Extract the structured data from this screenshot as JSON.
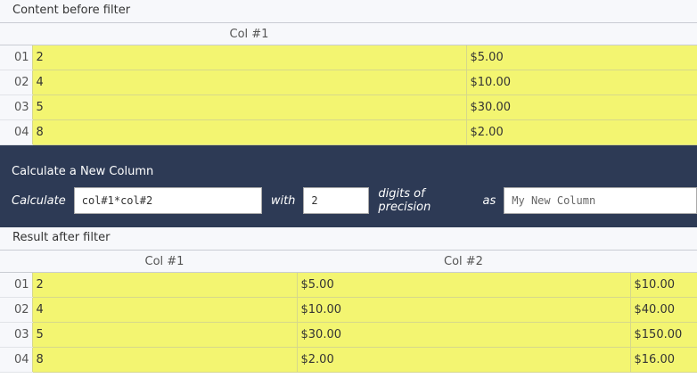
{
  "before": {
    "label": "Content before filter",
    "columns": [
      "Col #1"
    ],
    "rows": [
      {
        "num": "01",
        "c1": "2",
        "c2": "$5.00"
      },
      {
        "num": "02",
        "c1": "4",
        "c2": "$10.00"
      },
      {
        "num": "03",
        "c1": "5",
        "c2": "$30.00"
      },
      {
        "num": "04",
        "c1": "8",
        "c2": "$2.00"
      }
    ]
  },
  "calculator": {
    "title": "Calculate a New Column",
    "calculate_label": "Calculate",
    "expression_value": "col#1*col#2",
    "with_label": "with",
    "precision_value": "2",
    "digits_label": "digits of precision",
    "as_label": "as",
    "name_placeholder": "My New Column"
  },
  "after": {
    "label": "Result after filter",
    "columns": [
      "Col #1",
      "Col #2"
    ],
    "rows": [
      {
        "num": "01",
        "c1": "2",
        "c2": "$5.00",
        "c3": "$10.00"
      },
      {
        "num": "02",
        "c1": "4",
        "c2": "$10.00",
        "c3": "$40.00"
      },
      {
        "num": "03",
        "c1": "5",
        "c2": "$30.00",
        "c3": "$150.00"
      },
      {
        "num": "04",
        "c1": "8",
        "c2": "$2.00",
        "c3": "$16.00"
      }
    ]
  },
  "colors": {
    "cell_highlight": "#f3f571",
    "calculator_bg": "#2d3a55"
  }
}
